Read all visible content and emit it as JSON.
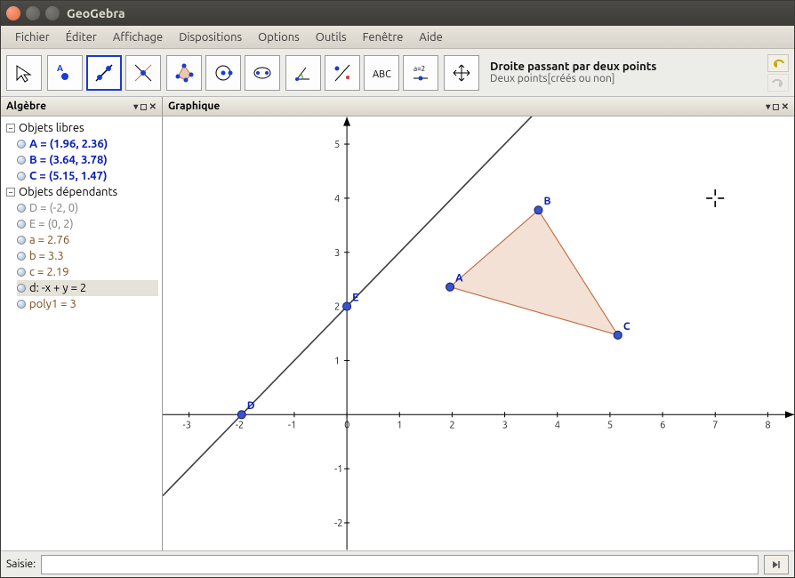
{
  "window": {
    "title": "GeoGebra"
  },
  "menu": [
    "Fichier",
    "Éditer",
    "Affichage",
    "Dispositions",
    "Options",
    "Outils",
    "Fenêtre",
    "Aide"
  ],
  "toolbar": {
    "selected_index": 2,
    "buttons": [
      "move-arrow",
      "point",
      "line-two-points",
      "perpendicular",
      "polygon",
      "circle-center",
      "ellipse",
      "angle",
      "reflect",
      "text-label",
      "slider",
      "pan"
    ],
    "desc_title": "Droite passant par deux points",
    "desc_sub": "Deux points[créés ou non]"
  },
  "panels": {
    "algebra": {
      "title": "Algèbre",
      "groups": [
        {
          "label": "Objets libres",
          "items": [
            {
              "text": "A = (1.96, 2.36)",
              "cls": "c-free"
            },
            {
              "text": "B = (3.64, 3.78)",
              "cls": "c-free"
            },
            {
              "text": "C = (5.15, 1.47)",
              "cls": "c-free"
            }
          ]
        },
        {
          "label": "Objets dépendants",
          "items": [
            {
              "text": "D = (-2, 0)",
              "cls": "c-gray"
            },
            {
              "text": "E = (0, 2)",
              "cls": "c-gray"
            },
            {
              "text": "a = 2.76",
              "cls": "c-brown"
            },
            {
              "text": "b = 3.3",
              "cls": "c-brown"
            },
            {
              "text": "c = 2.19",
              "cls": "c-brown"
            },
            {
              "text": "d: -x + y = 2",
              "cls": "",
              "selected": true
            },
            {
              "text": "poly1 = 3",
              "cls": "c-brown"
            }
          ]
        }
      ]
    },
    "graph": {
      "title": "Graphique"
    }
  },
  "saisie": {
    "label": "Saisie:",
    "value": ""
  },
  "chart_data": {
    "type": "scatter",
    "title": "",
    "xlabel": "",
    "ylabel": "",
    "xlim": [
      -3.5,
      8.5
    ],
    "ylim": [
      -2.5,
      5.5
    ],
    "xticks": [
      -3,
      -2,
      -1,
      0,
      1,
      2,
      3,
      4,
      5,
      6,
      7,
      8
    ],
    "yticks": [
      -2,
      -1,
      1,
      2,
      3,
      4,
      5
    ],
    "points": [
      {
        "name": "A",
        "x": 1.96,
        "y": 2.36
      },
      {
        "name": "B",
        "x": 3.64,
        "y": 3.78
      },
      {
        "name": "C",
        "x": 5.15,
        "y": 1.47
      },
      {
        "name": "D",
        "x": -2,
        "y": 0
      },
      {
        "name": "E",
        "x": 0,
        "y": 2
      }
    ],
    "polygon": [
      "A",
      "B",
      "C"
    ],
    "lines": [
      {
        "name": "d",
        "equation": "-x + y = 2",
        "p1": [
          -3.5,
          -1.5
        ],
        "p2": [
          5.5,
          7.5
        ]
      }
    ]
  }
}
